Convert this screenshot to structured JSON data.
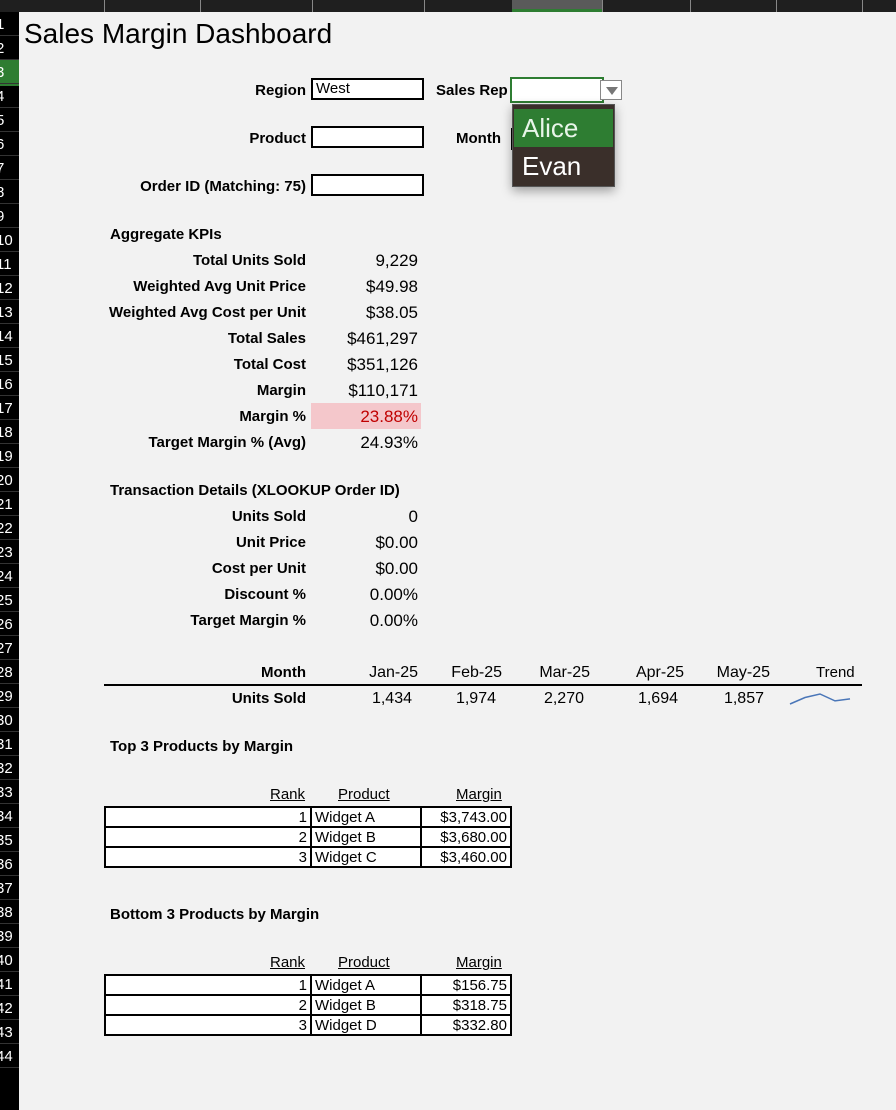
{
  "title": "Sales Margin Dashboard",
  "row_numbers": [
    "1",
    "2",
    "3",
    "4",
    "5",
    "6",
    "7",
    "8",
    "9",
    "10",
    "11",
    "12",
    "13",
    "14",
    "15",
    "16",
    "17",
    "18",
    "19",
    "20",
    "21",
    "22",
    "23",
    "24",
    "25",
    "26",
    "27",
    "28",
    "29",
    "30",
    "31",
    "32",
    "33",
    "34",
    "35",
    "36",
    "37",
    "38",
    "39",
    "40",
    "41",
    "42",
    "43",
    "44"
  ],
  "filters": {
    "region_label": "Region",
    "region_value": "West",
    "sales_rep_label": "Sales Rep",
    "sales_rep_value": "",
    "product_label": "Product",
    "product_value": "",
    "month_label": "Month",
    "order_id_label": "Order ID (Matching: 75)",
    "order_id_value": ""
  },
  "dropdown": {
    "options": [
      "Alice",
      "Evan"
    ],
    "highlighted": "Alice"
  },
  "kpis": {
    "header": "Aggregate KPIs",
    "rows": [
      {
        "label": "Total Units Sold",
        "value": "9,229"
      },
      {
        "label": "Weighted Avg Unit Price",
        "value": "$49.98"
      },
      {
        "label": "Weighted Avg Cost per Unit",
        "value": "$38.05"
      },
      {
        "label": "Total Sales",
        "value": "$461,297"
      },
      {
        "label": "Total Cost",
        "value": "$351,126"
      },
      {
        "label": "Margin",
        "value": "$110,171"
      },
      {
        "label": "Margin %",
        "value": "23.88%"
      },
      {
        "label": "Target Margin % (Avg)",
        "value": "24.93%"
      }
    ],
    "alert_color": "#f4c7cb",
    "alert_text_color": "#c00000"
  },
  "transaction": {
    "header": "Transaction Details (XLOOKUP Order ID)",
    "rows": [
      {
        "label": "Units Sold",
        "value": "0"
      },
      {
        "label": "Unit Price",
        "value": "$0.00"
      },
      {
        "label": "Cost per Unit",
        "value": "$0.00"
      },
      {
        "label": "Discount %",
        "value": "0.00%"
      },
      {
        "label": "Target Margin %",
        "value": "0.00%"
      }
    ]
  },
  "monthly": {
    "month_label": "Month",
    "units_label": "Units Sold",
    "trend_label": "Trend",
    "months": [
      "Jan-25",
      "Feb-25",
      "Mar-25",
      "Apr-25",
      "May-25"
    ],
    "units": [
      "1,434",
      "1,974",
      "2,270",
      "1,694",
      "1,857"
    ],
    "unit_values": [
      1434,
      1974,
      2270,
      1694,
      1857
    ],
    "sparkline_color": "#4a76b8"
  },
  "top3": {
    "header": "Top 3 Products by Margin",
    "col_rank": "Rank",
    "col_product": "Product",
    "col_margin": "Margin",
    "rows": [
      {
        "rank": "1",
        "product": "Widget A",
        "margin": "$3,743.00"
      },
      {
        "rank": "2",
        "product": "Widget B",
        "margin": "$3,680.00"
      },
      {
        "rank": "3",
        "product": "Widget C",
        "margin": "$3,460.00"
      }
    ]
  },
  "bottom3": {
    "header": "Bottom 3 Products by Margin",
    "col_rank": "Rank",
    "col_product": "Product",
    "col_margin": "Margin",
    "rows": [
      {
        "rank": "1",
        "product": "Widget A",
        "margin": "$156.75"
      },
      {
        "rank": "2",
        "product": "Widget B",
        "margin": "$318.75"
      },
      {
        "rank": "3",
        "product": "Widget D",
        "margin": "$332.80"
      }
    ]
  }
}
